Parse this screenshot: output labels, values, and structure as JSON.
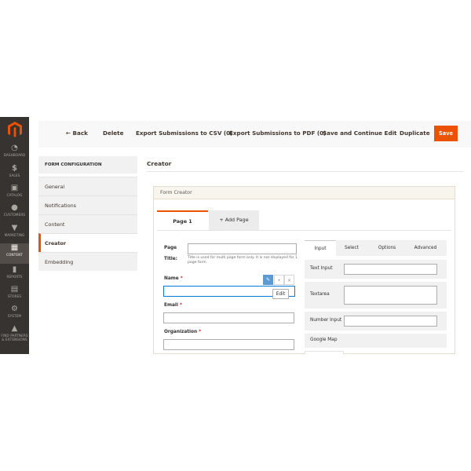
{
  "sidebar": {
    "items": [
      {
        "label": "DASHBOARD",
        "icon": "speedometer-icon"
      },
      {
        "label": "SALES",
        "icon": "dollar-icon"
      },
      {
        "label": "CATALOG",
        "icon": "cube-icon"
      },
      {
        "label": "CUSTOMERS",
        "icon": "person-icon"
      },
      {
        "label": "MARKETING",
        "icon": "megaphone-icon"
      },
      {
        "label": "CONTENT",
        "icon": "layout-icon"
      },
      {
        "label": "REPORTS",
        "icon": "bar-chart-icon"
      },
      {
        "label": "STORES",
        "icon": "storefront-icon"
      },
      {
        "label": "SYSTEM",
        "icon": "gear-icon"
      },
      {
        "label": "FIND PARTNERS & EXTENSIONS",
        "icon": "partners-icon"
      }
    ],
    "active": "CONTENT",
    "brand_color": "#eb5202"
  },
  "toolbar": {
    "back": "← Back",
    "delete": "Delete",
    "export_csv": "Export Submissions to CSV (0)",
    "export_pdf": "Export Submissions to PDF (0)",
    "save_continue": "Save and Continue Edit",
    "duplicate": "Duplicate",
    "save": "Save"
  },
  "config": {
    "header": "FORM CONFIGURATION",
    "items": [
      "General",
      "Notifications",
      "Content",
      "Creator",
      "Embedding"
    ],
    "active": "Creator"
  },
  "creator": {
    "section_title": "Creator",
    "box_title": "Form Creator",
    "page_tabs": [
      "Page 1",
      "+ Add Page"
    ],
    "page_title_label_1": "Page",
    "page_title_label_2": "Title:",
    "page_title_note": "Title is used for multi page form only. It is not displayed for 1 page form.",
    "fields": [
      {
        "label": "Name",
        "required": true
      },
      {
        "label": "Email",
        "required": true
      },
      {
        "label": "Organization",
        "required": true
      }
    ],
    "edit_tooltip": "Edit",
    "palette_tabs": [
      "Input",
      "Select",
      "Options",
      "Advanced"
    ],
    "palette_active": "Input",
    "palette_items": [
      "Text Input",
      "Textarea",
      "Number Input",
      "Google Map"
    ]
  }
}
